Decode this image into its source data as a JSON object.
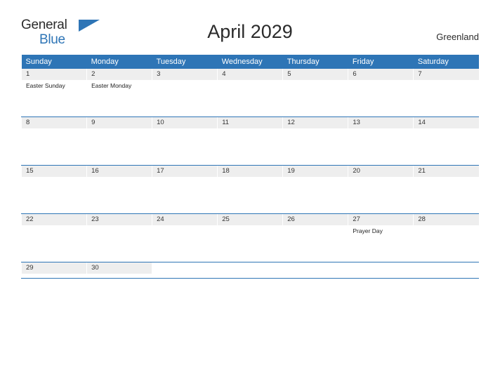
{
  "brand": {
    "name_part1": "General",
    "name_part2": "Blue",
    "flag_icon": "flag-triangle-icon"
  },
  "header": {
    "title": "April 2029",
    "region": "Greenland"
  },
  "colors": {
    "accent": "#2e75b6",
    "daynum_bg": "#eeeeee",
    "text": "#2b2b2b"
  },
  "calendar": {
    "weekdays": [
      "Sunday",
      "Monday",
      "Tuesday",
      "Wednesday",
      "Thursday",
      "Friday",
      "Saturday"
    ],
    "weeks": [
      [
        {
          "day": "1",
          "events": [
            "Easter Sunday"
          ]
        },
        {
          "day": "2",
          "events": [
            "Easter Monday"
          ]
        },
        {
          "day": "3",
          "events": []
        },
        {
          "day": "4",
          "events": []
        },
        {
          "day": "5",
          "events": []
        },
        {
          "day": "6",
          "events": []
        },
        {
          "day": "7",
          "events": []
        }
      ],
      [
        {
          "day": "8",
          "events": []
        },
        {
          "day": "9",
          "events": []
        },
        {
          "day": "10",
          "events": []
        },
        {
          "day": "11",
          "events": []
        },
        {
          "day": "12",
          "events": []
        },
        {
          "day": "13",
          "events": []
        },
        {
          "day": "14",
          "events": []
        }
      ],
      [
        {
          "day": "15",
          "events": []
        },
        {
          "day": "16",
          "events": []
        },
        {
          "day": "17",
          "events": []
        },
        {
          "day": "18",
          "events": []
        },
        {
          "day": "19",
          "events": []
        },
        {
          "day": "20",
          "events": []
        },
        {
          "day": "21",
          "events": []
        }
      ],
      [
        {
          "day": "22",
          "events": []
        },
        {
          "day": "23",
          "events": []
        },
        {
          "day": "24",
          "events": []
        },
        {
          "day": "25",
          "events": []
        },
        {
          "day": "26",
          "events": []
        },
        {
          "day": "27",
          "events": [
            "Prayer Day"
          ]
        },
        {
          "day": "28",
          "events": []
        }
      ],
      [
        {
          "day": "29",
          "events": []
        },
        {
          "day": "30",
          "events": []
        },
        {
          "day": "",
          "events": []
        },
        {
          "day": "",
          "events": []
        },
        {
          "day": "",
          "events": []
        },
        {
          "day": "",
          "events": []
        },
        {
          "day": "",
          "events": []
        }
      ]
    ]
  }
}
